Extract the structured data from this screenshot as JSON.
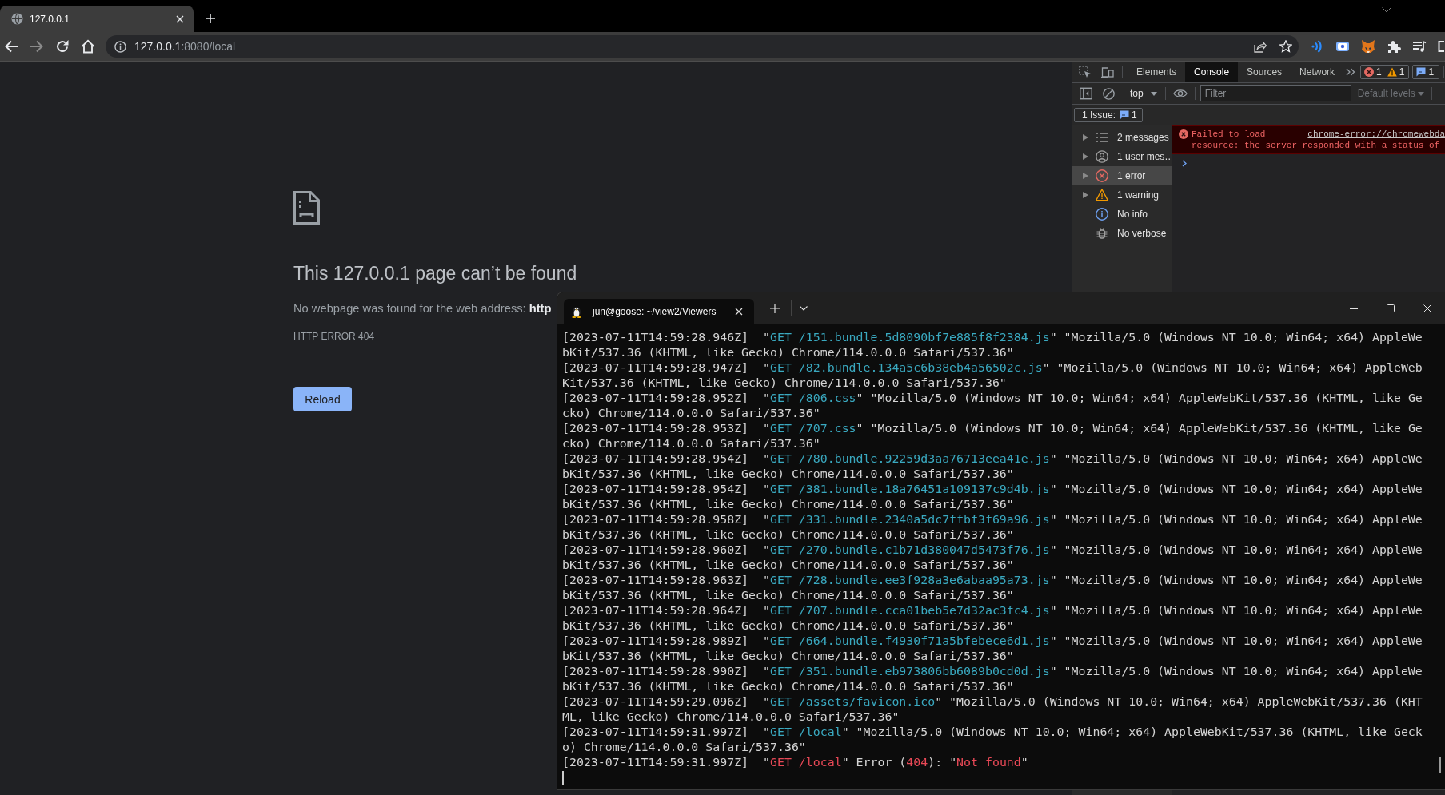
{
  "browser": {
    "tabs": [
      {
        "title": "127.0.0.1",
        "selected": true
      }
    ],
    "address": {
      "host": "127.0.0.1",
      "path": ":8080/local"
    }
  },
  "error_page": {
    "title": "This 127.0.0.1 page can’t be found",
    "message": "No webpage was found for the web address: **http**",
    "code": "HTTP ERROR 404",
    "button": "Reload"
  },
  "devtools": {
    "tabs": [
      {
        "label": "Elements",
        "selected": false
      },
      {
        "label": "Console",
        "selected": true
      },
      {
        "label": "Sources",
        "selected": false
      },
      {
        "label": "Network",
        "selected": false
      }
    ],
    "counts": {
      "errors": "1",
      "warnings": "1",
      "issues": "1"
    },
    "context": "top",
    "filter": {
      "placeholder": "Filter"
    },
    "levels": {
      "label": "Default levels",
      "disabled": true
    },
    "issues": {
      "label": "1 Issue:",
      "count": "1"
    },
    "sidebar": [
      {
        "label": "2 messages",
        "kind": "messages",
        "expandable": true,
        "selected": false
      },
      {
        "label": "1 user mes…",
        "kind": "user",
        "expandable": true,
        "selected": false
      },
      {
        "label": "1 error",
        "kind": "error",
        "expandable": true,
        "selected": true
      },
      {
        "label": "1 warning",
        "kind": "warning",
        "expandable": true,
        "selected": false
      },
      {
        "label": "No info",
        "kind": "info",
        "expandable": false,
        "selected": false
      },
      {
        "label": "No verbose",
        "kind": "verbose",
        "expandable": false,
        "selected": false
      }
    ],
    "messages": [
      {
        "kind": "error",
        "lines": [
          "Failed to load",
          "resource: the server responded with a status of"
        ],
        "source": "chrome-error://chromewebda"
      }
    ]
  },
  "terminal": {
    "tab_title": "jun@goose: ~/view2/Viewers",
    "log": [
      {
        "parts": [
          {
            "text": "[2023-07-11T14:59:28.946Z]  \"",
            "kind": "plain"
          },
          {
            "text": "GET /151.bundle.5d8090bf7e885f8f2384.js",
            "kind": "request"
          },
          {
            "text": "\" \"Mozilla/5.0 (Windows NT 10.0; Win64; x64) AppleWebKit/537.36 (KHTML, like Gecko) Chrome/114.0.0.0 Safari/537.36\"",
            "kind": "plain"
          }
        ]
      },
      {
        "parts": [
          {
            "text": "[2023-07-11T14:59:28.947Z]  \"",
            "kind": "plain"
          },
          {
            "text": "GET /82.bundle.134a5c6b38eb4a56502c.js",
            "kind": "request"
          },
          {
            "text": "\" \"Mozilla/5.0 (Windows NT 10.0; Win64; x64) AppleWebKit/537.36 (KHTML, like Gecko) Chrome/114.0.0.0 Safari/537.36\"",
            "kind": "plain"
          }
        ]
      },
      {
        "parts": [
          {
            "text": "[2023-07-11T14:59:28.952Z]  \"",
            "kind": "plain"
          },
          {
            "text": "GET /806.css",
            "kind": "request"
          },
          {
            "text": "\" \"Mozilla/5.0 (Windows NT 10.0; Win64; x64) AppleWebKit/537.36 (KHTML, like Gecko) Chrome/114.0.0.0 Safari/537.36\"",
            "kind": "plain"
          }
        ]
      },
      {
        "parts": [
          {
            "text": "[2023-07-11T14:59:28.953Z]  \"",
            "kind": "plain"
          },
          {
            "text": "GET /707.css",
            "kind": "request"
          },
          {
            "text": "\" \"Mozilla/5.0 (Windows NT 10.0; Win64; x64) AppleWebKit/537.36 (KHTML, like Gecko) Chrome/114.0.0.0 Safari/537.36\"",
            "kind": "plain"
          }
        ]
      },
      {
        "parts": [
          {
            "text": "[2023-07-11T14:59:28.954Z]  \"",
            "kind": "plain"
          },
          {
            "text": "GET /780.bundle.92259d3aa76713eea41e.js",
            "kind": "request"
          },
          {
            "text": "\" \"Mozilla/5.0 (Windows NT 10.0; Win64; x64) AppleWebKit/537.36 (KHTML, like Gecko) Chrome/114.0.0.0 Safari/537.36\"",
            "kind": "plain"
          }
        ]
      },
      {
        "parts": [
          {
            "text": "[2023-07-11T14:59:28.954Z]  \"",
            "kind": "plain"
          },
          {
            "text": "GET /381.bundle.18a76451a109137c9d4b.js",
            "kind": "request"
          },
          {
            "text": "\" \"Mozilla/5.0 (Windows NT 10.0; Win64; x64) AppleWebKit/537.36 (KHTML, like Gecko) Chrome/114.0.0.0 Safari/537.36\"",
            "kind": "plain"
          }
        ]
      },
      {
        "parts": [
          {
            "text": "[2023-07-11T14:59:28.958Z]  \"",
            "kind": "plain"
          },
          {
            "text": "GET /331.bundle.2340a5dc7ffbf3f69a96.js",
            "kind": "request"
          },
          {
            "text": "\" \"Mozilla/5.0 (Windows NT 10.0; Win64; x64) AppleWebKit/537.36 (KHTML, like Gecko) Chrome/114.0.0.0 Safari/537.36\"",
            "kind": "plain"
          }
        ]
      },
      {
        "parts": [
          {
            "text": "[2023-07-11T14:59:28.960Z]  \"",
            "kind": "plain"
          },
          {
            "text": "GET /270.bundle.c1b71d380047d5473f76.js",
            "kind": "request"
          },
          {
            "text": "\" \"Mozilla/5.0 (Windows NT 10.0; Win64; x64) AppleWebKit/537.36 (KHTML, like Gecko) Chrome/114.0.0.0 Safari/537.36\"",
            "kind": "plain"
          }
        ]
      },
      {
        "parts": [
          {
            "text": "[2023-07-11T14:59:28.963Z]  \"",
            "kind": "plain"
          },
          {
            "text": "GET /728.bundle.ee3f928a3e6abaa95a73.js",
            "kind": "request"
          },
          {
            "text": "\" \"Mozilla/5.0 (Windows NT 10.0; Win64; x64) AppleWebKit/537.36 (KHTML, like Gecko) Chrome/114.0.0.0 Safari/537.36\"",
            "kind": "plain"
          }
        ]
      },
      {
        "parts": [
          {
            "text": "[2023-07-11T14:59:28.964Z]  \"",
            "kind": "plain"
          },
          {
            "text": "GET /707.bundle.cca01beb5e7d32ac3fc4.js",
            "kind": "request"
          },
          {
            "text": "\" \"Mozilla/5.0 (Windows NT 10.0; Win64; x64) AppleWebKit/537.36 (KHTML, like Gecko) Chrome/114.0.0.0 Safari/537.36\"",
            "kind": "plain"
          }
        ]
      },
      {
        "parts": [
          {
            "text": "[2023-07-11T14:59:28.989Z]  \"",
            "kind": "plain"
          },
          {
            "text": "GET /664.bundle.f4930f71a5bfebece6d1.js",
            "kind": "request"
          },
          {
            "text": "\" \"Mozilla/5.0 (Windows NT 10.0; Win64; x64) AppleWebKit/537.36 (KHTML, like Gecko) Chrome/114.0.0.0 Safari/537.36\"",
            "kind": "plain"
          }
        ]
      },
      {
        "parts": [
          {
            "text": "[2023-07-11T14:59:28.990Z]  \"",
            "kind": "plain"
          },
          {
            "text": "GET /351.bundle.eb973806bb6089b0cd0d.js",
            "kind": "request"
          },
          {
            "text": "\" \"Mozilla/5.0 (Windows NT 10.0; Win64; x64) AppleWebKit/537.36 (KHTML, like Gecko) Chrome/114.0.0.0 Safari/537.36\"",
            "kind": "plain"
          }
        ]
      },
      {
        "parts": [
          {
            "text": "[2023-07-11T14:59:29.096Z]  \"",
            "kind": "plain"
          },
          {
            "text": "GET /assets/favicon.ico",
            "kind": "request"
          },
          {
            "text": "\" \"Mozilla/5.0 (Windows NT 10.0; Win64; x64) AppleWebKit/537.36 (KHTML, like Gecko) Chrome/114.0.0.0 Safari/537.36\"",
            "kind": "plain"
          }
        ]
      },
      {
        "parts": [
          {
            "text": "[2023-07-11T14:59:31.997Z]  \"",
            "kind": "plain"
          },
          {
            "text": "GET /local",
            "kind": "request"
          },
          {
            "text": "\" \"Mozilla/5.0 (Windows NT 10.0; Win64; x64) AppleWebKit/537.36 (KHTML, like Gecko) Chrome/114.0.0.0 Safari/537.36\"",
            "kind": "plain"
          }
        ]
      },
      {
        "parts": [
          {
            "text": "[2023-07-11T14:59:31.997Z]  \"",
            "kind": "plain"
          },
          {
            "text": "GET /local",
            "kind": "error"
          },
          {
            "text": "\" Error (",
            "kind": "plain"
          },
          {
            "text": "404",
            "kind": "error"
          },
          {
            "text": "): \"",
            "kind": "plain"
          },
          {
            "text": "Not found",
            "kind": "error"
          },
          {
            "text": "\"",
            "kind": "plain"
          }
        ]
      }
    ]
  }
}
